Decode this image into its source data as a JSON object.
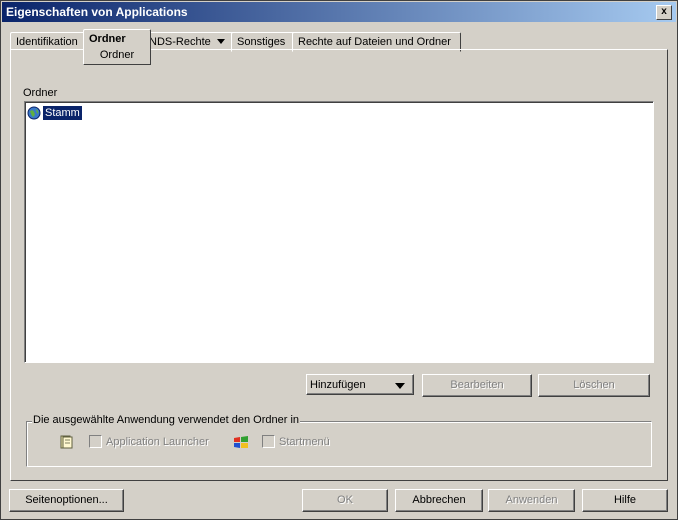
{
  "window": {
    "title": "Eigenschaften von Applications",
    "close_label": "x"
  },
  "tabs": [
    {
      "label": "Identifikation"
    },
    {
      "label": "Ordner",
      "sublabel": "Ordner",
      "active": true
    },
    {
      "label": "NDS-Rechte",
      "has_dropdown": true
    },
    {
      "label": "Sonstiges"
    },
    {
      "label": "Rechte auf Dateien und Ordner"
    }
  ],
  "folder_section": {
    "label": "Ordner",
    "items": [
      {
        "label": "Stamm",
        "icon": "globe-icon",
        "selected": true
      }
    ]
  },
  "folder_buttons": {
    "add": "Hinzufügen",
    "edit": "Bearbeiten",
    "delete": "Löschen"
  },
  "usage_group": {
    "label": "Die ausgewählte Anwendung verwendet den Ordner in",
    "application_launcher": "Application Launcher",
    "start_menu": "Startmenü"
  },
  "bottom_buttons": {
    "page_options": "Seitenoptionen...",
    "ok": "OK",
    "cancel": "Abbrechen",
    "apply": "Anwenden",
    "help": "Hilfe"
  },
  "colors": {
    "titlebar_start": "#0a246a",
    "titlebar_end": "#a6caf0",
    "selection": "#0a246a",
    "face": "#d4d0c8"
  }
}
